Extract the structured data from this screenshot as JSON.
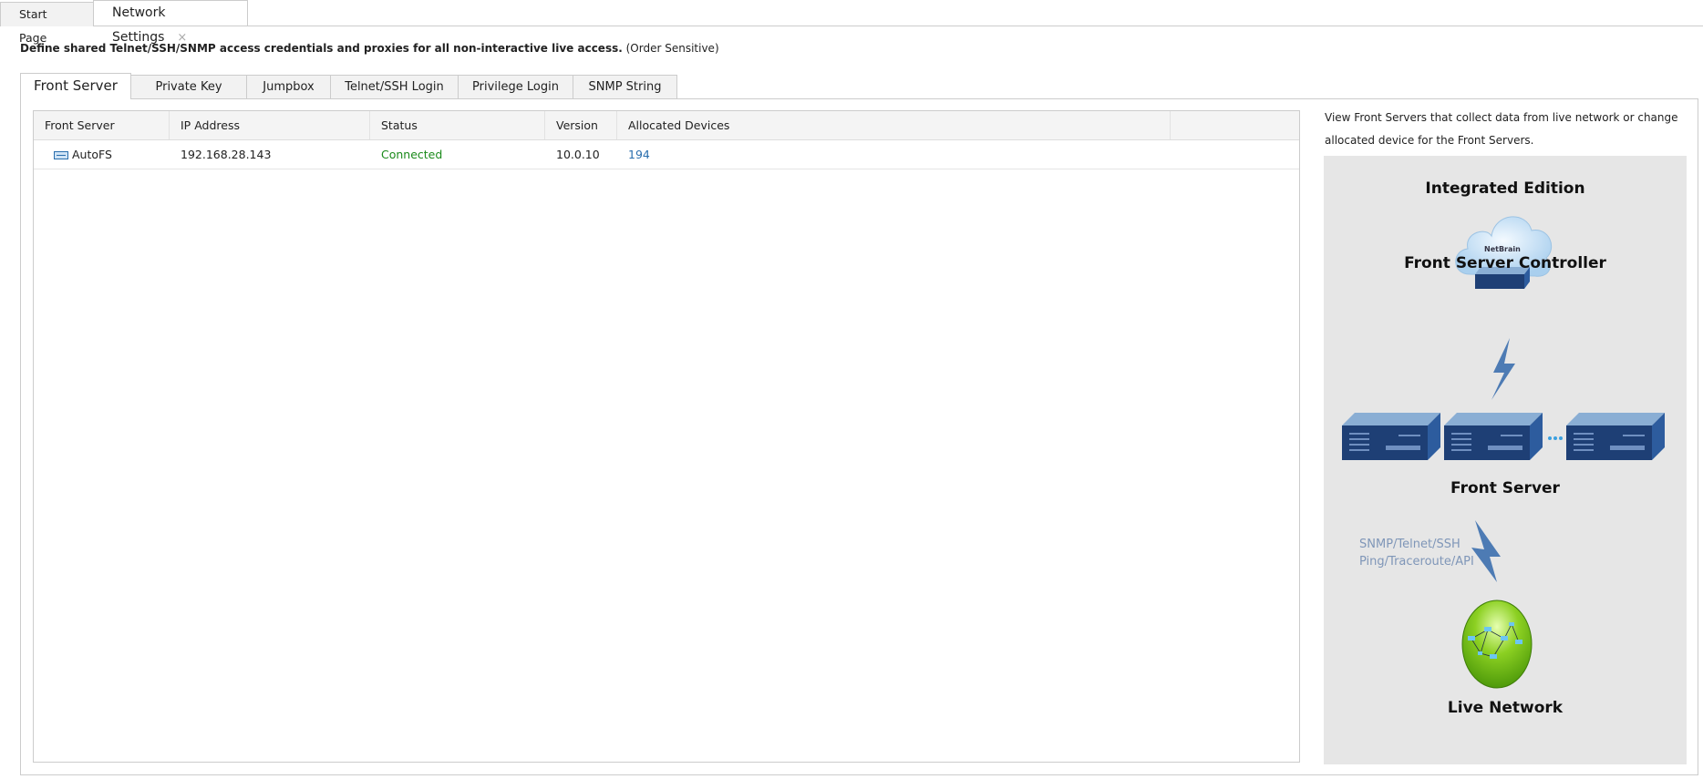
{
  "doc_tabs": [
    {
      "label": "Start Page"
    },
    {
      "label": "Network Settings",
      "close": "×"
    }
  ],
  "description": {
    "bold": "Define shared Telnet/SSH/SNMP access credentials and proxies for all non-interactive live access.",
    "note": "(Order Sensitive)"
  },
  "tabs": [
    "Front Server",
    "Private Key",
    "Jumpbox",
    "Telnet/SSH Login",
    "Privilege Login",
    "SNMP String"
  ],
  "table": {
    "columns": [
      "Front Server",
      "IP Address",
      "Status",
      "Version",
      "Allocated Devices"
    ],
    "rows": [
      {
        "name": "AutoFS",
        "ip": "192.168.28.143",
        "status": "Connected",
        "version": "10.0.10",
        "devices": "194"
      }
    ]
  },
  "info": "View Front Servers that collect data from live network or change allocated device for the Front Servers.",
  "diagram": {
    "title": "Integrated Edition",
    "logo": "NetBrain",
    "controller": "Front Server Controller",
    "front_server": "Front Server",
    "protocols1": "SNMP/Telnet/SSH",
    "protocols2": "Ping/Traceroute/API",
    "live": "Live Network"
  },
  "colors": {
    "connected": "#1a8a1a",
    "link": "#2a6ead"
  }
}
